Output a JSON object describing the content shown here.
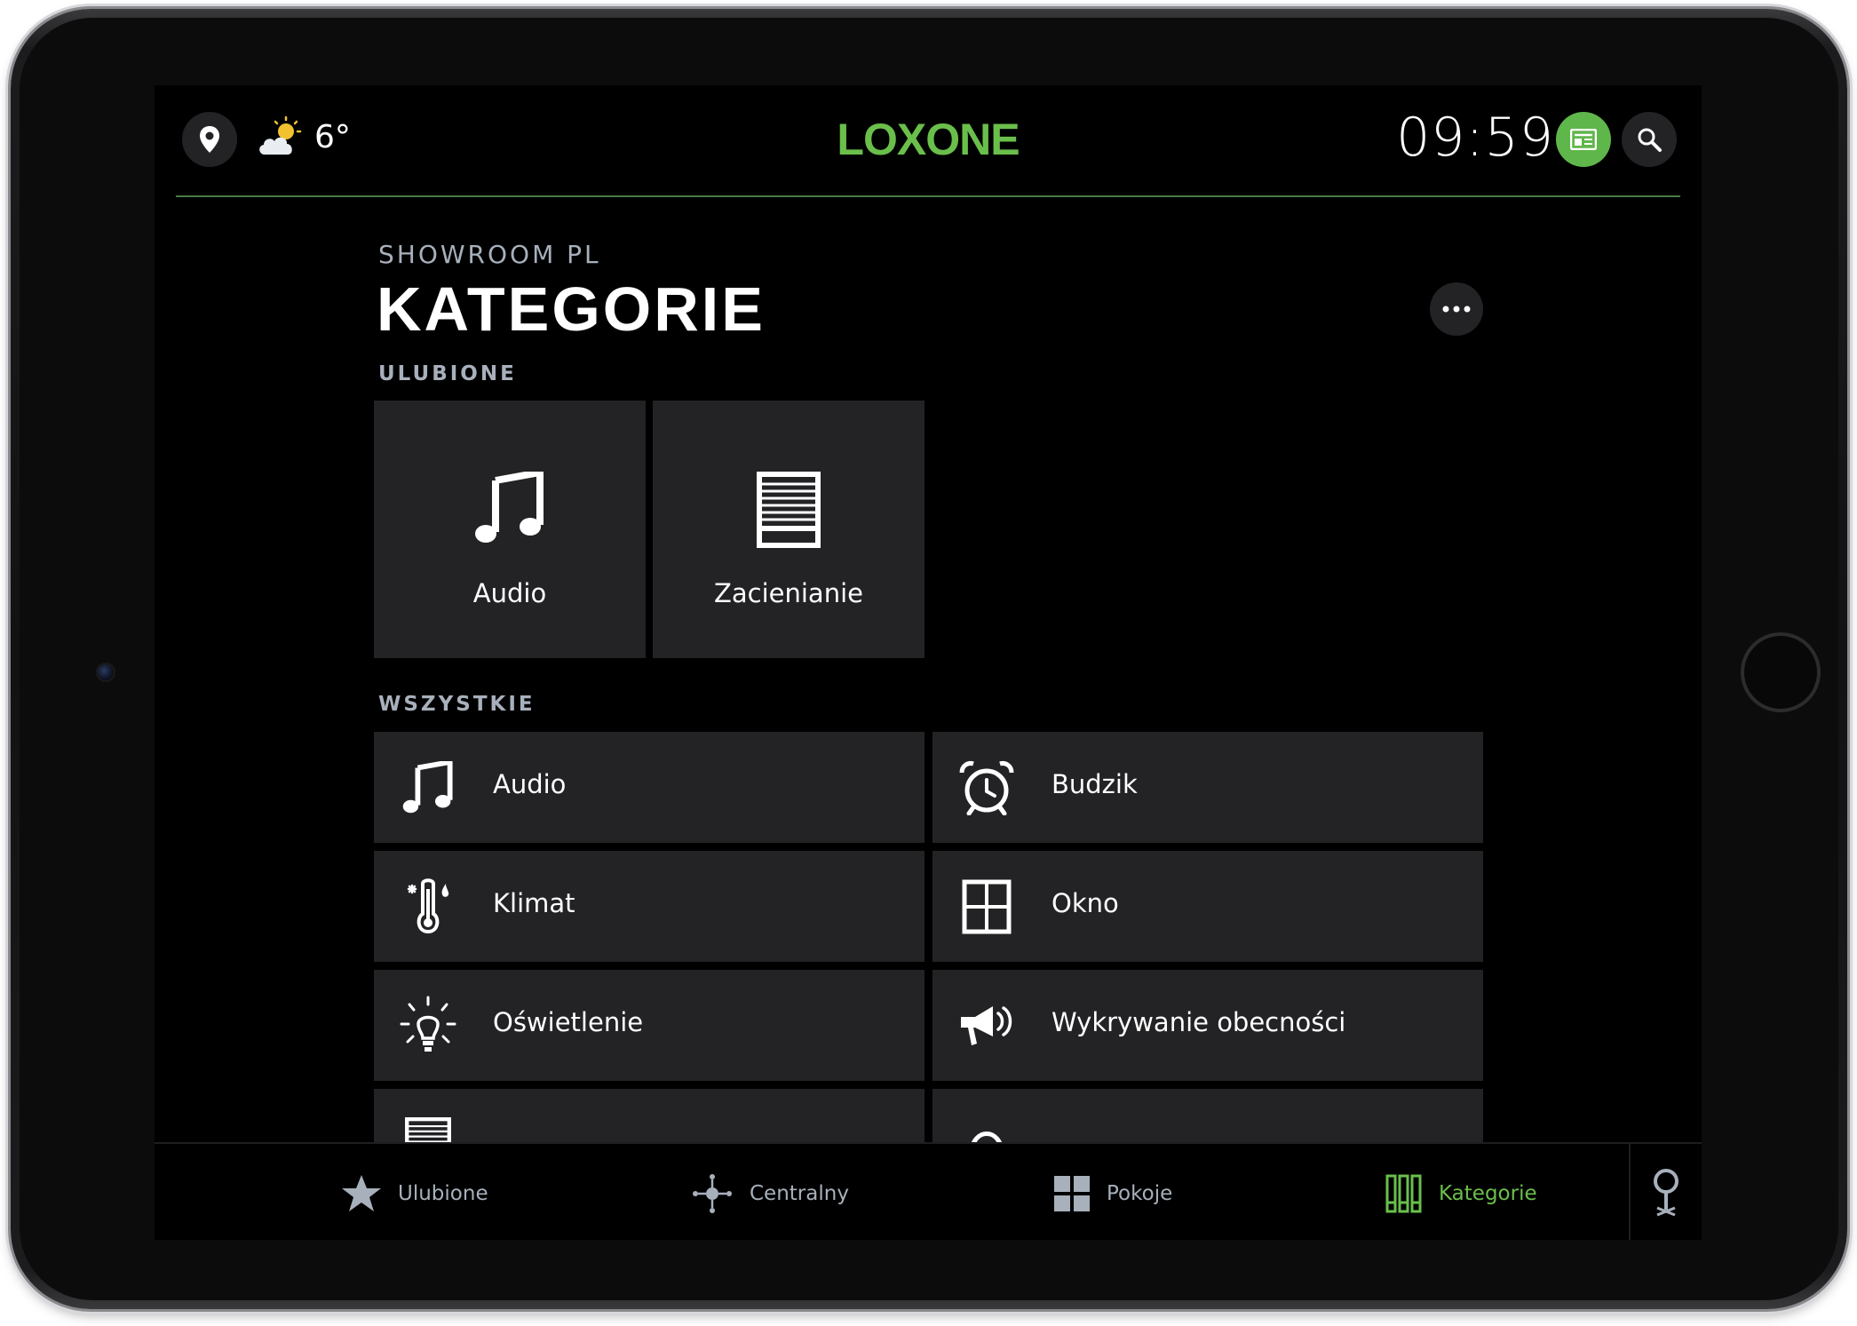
{
  "header": {
    "temperature": "6°",
    "logo": "LOXONE",
    "time": "09:59"
  },
  "page": {
    "subtitle": "SHOWROOM PL",
    "title": "KATEGORIE"
  },
  "favorites": {
    "label": "ULUBIONE",
    "items": [
      {
        "label": "Audio",
        "icon": "music-note-icon"
      },
      {
        "label": "Zacienianie",
        "icon": "blinds-icon"
      }
    ]
  },
  "all": {
    "label": "WSZYSTKIE",
    "items": [
      {
        "label": "Audio",
        "icon": "music-note-icon"
      },
      {
        "label": "Budzik",
        "icon": "alarm-clock-icon"
      },
      {
        "label": "Klimat",
        "icon": "thermometer-icon"
      },
      {
        "label": "Okno",
        "icon": "window-icon"
      },
      {
        "label": "Oświetlenie",
        "icon": "light-bulb-icon"
      },
      {
        "label": "Wykrywanie obecności",
        "icon": "megaphone-icon"
      }
    ]
  },
  "tabs": [
    {
      "label": "Ulubione",
      "icon": "star-icon",
      "active": false
    },
    {
      "label": "Centralny",
      "icon": "central-icon",
      "active": false
    },
    {
      "label": "Pokoje",
      "icon": "rooms-grid-icon",
      "active": false
    },
    {
      "label": "Kategorie",
      "icon": "categories-icon",
      "active": true
    }
  ],
  "colors": {
    "accent": "#6abf4b",
    "tile": "#232326",
    "muted_text": "#a7b0bb"
  }
}
